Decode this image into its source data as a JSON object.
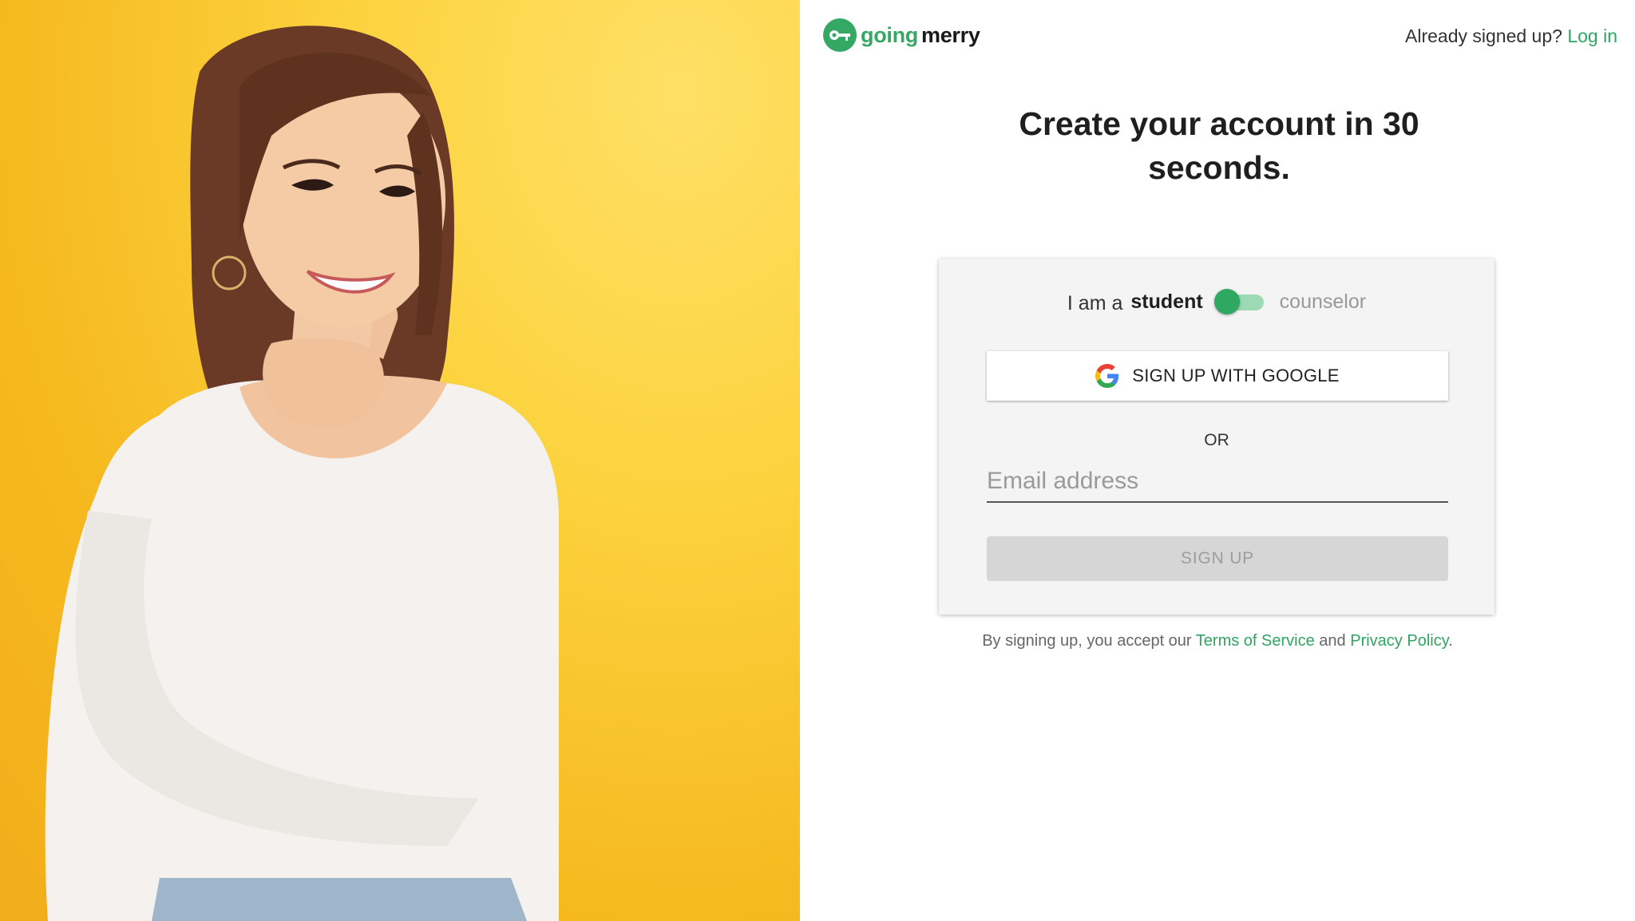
{
  "brand": {
    "name_part1": "going",
    "name_part2": "merry",
    "accent_color": "#35a865"
  },
  "header": {
    "already_text": "Already signed up?",
    "login_link": "Log in"
  },
  "headline": "Create your account in 30 seconds.",
  "role_toggle": {
    "prefix": "I am a",
    "option_selected": "student",
    "option_other": "counselor",
    "state": "student"
  },
  "google_button": {
    "label": "SIGN UP WITH GOOGLE",
    "icon": "google-g-icon"
  },
  "divider_text": "OR",
  "email_field": {
    "placeholder": "Email address",
    "value": ""
  },
  "signup_button": {
    "label": "SIGN UP",
    "disabled": true
  },
  "legal": {
    "prefix": "By signing up, you accept our",
    "terms_link": "Terms of Service",
    "conjunction": "and",
    "privacy_link": "Privacy Policy",
    "suffix": "."
  },
  "hero_image": {
    "icon": "photo-woman-smiling",
    "background_color": "#f9c42c"
  }
}
